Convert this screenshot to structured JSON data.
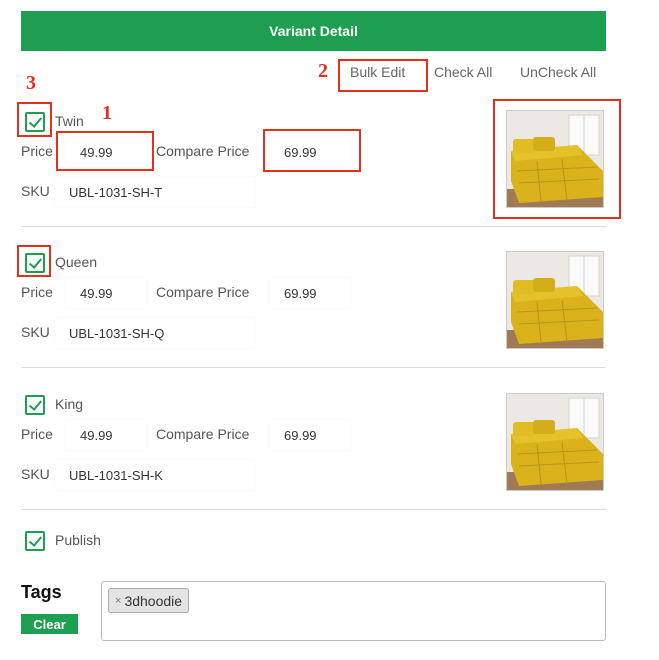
{
  "header": {
    "title": "Variant Detail"
  },
  "actions": {
    "bulk_edit": "Bulk Edit",
    "check_all": "Check All",
    "uncheck_all": "UnCheck All"
  },
  "labels": {
    "price": "Price",
    "compare_price": "Compare Price",
    "sku": "SKU"
  },
  "variants": [
    {
      "name": "Twin",
      "checked": true,
      "price": "49.99",
      "compare_price": "69.99",
      "sku": "UBL-1031-SH-T"
    },
    {
      "name": "Queen",
      "checked": true,
      "price": "49.99",
      "compare_price": "69.99",
      "sku": "UBL-1031-SH-Q"
    },
    {
      "name": "King",
      "checked": true,
      "price": "49.99",
      "compare_price": "69.99",
      "sku": "UBL-1031-SH-K"
    }
  ],
  "publish": {
    "label": "Publish",
    "checked": true
  },
  "tags": {
    "title": "Tags",
    "clear_label": "Clear",
    "items": [
      "3dhoodie"
    ],
    "remove_glyph": "×"
  },
  "annotations": {
    "n1": "1",
    "n2": "2",
    "n3": "3"
  },
  "colors": {
    "accent": "#1e9e50",
    "annotation": "#e0301e"
  }
}
